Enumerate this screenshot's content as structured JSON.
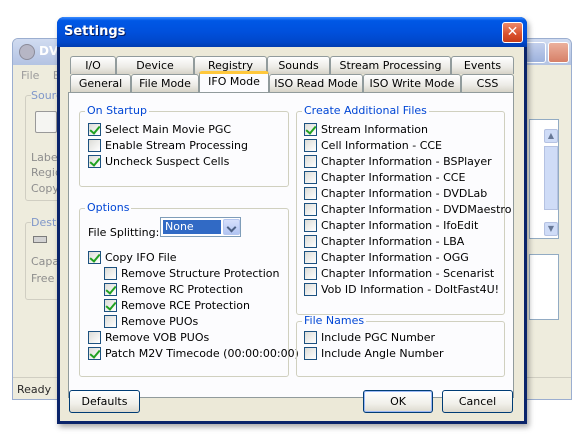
{
  "background_window": {
    "title": "DVD",
    "menu": [
      "File",
      "E"
    ],
    "labels": [
      "Sourc",
      "Label",
      "Regic",
      "Copy",
      "Desti",
      "Capa",
      "Free"
    ],
    "status": "Ready"
  },
  "dialog": {
    "title": "Settings",
    "close_label": "X"
  },
  "tabs": {
    "row1": [
      "I/O",
      "Device",
      "Registry",
      "Sounds",
      "Stream Processing",
      "Events"
    ],
    "row2": [
      "General",
      "File Mode",
      "IFO Mode",
      "ISO Read Mode",
      "ISO Write Mode",
      "CSS"
    ],
    "active": "IFO Mode"
  },
  "on_startup": {
    "title": "On Startup",
    "items": [
      {
        "label": "Select Main Movie PGC",
        "checked": true
      },
      {
        "label": "Enable Stream Processing",
        "checked": false
      },
      {
        "label": "Uncheck Suspect Cells",
        "checked": true
      }
    ]
  },
  "options": {
    "title": "Options",
    "file_splitting_label": "File Splitting:",
    "file_splitting_value": "None",
    "items": [
      {
        "label": "Copy IFO File",
        "checked": true,
        "indent": 0
      },
      {
        "label": "Remove Structure Protection",
        "checked": false,
        "indent": 1
      },
      {
        "label": "Remove RC Protection",
        "checked": true,
        "indent": 1
      },
      {
        "label": "Remove RCE Protection",
        "checked": true,
        "indent": 1
      },
      {
        "label": "Remove PUOs",
        "checked": false,
        "indent": 1
      },
      {
        "label": "Remove VOB PUOs",
        "checked": false,
        "indent": 0
      },
      {
        "label": "Patch M2V Timecode (00:00:00:00)",
        "checked": true,
        "indent": 0
      }
    ]
  },
  "create_files": {
    "title": "Create Additional Files",
    "items": [
      {
        "label": "Stream Information",
        "checked": true
      },
      {
        "label": "Cell Information - CCE",
        "checked": false
      },
      {
        "label": "Chapter Information - BSPlayer",
        "checked": false
      },
      {
        "label": "Chapter Information - CCE",
        "checked": false
      },
      {
        "label": "Chapter Information - DVDLab",
        "checked": false
      },
      {
        "label": "Chapter Information - DVDMaestro",
        "checked": false
      },
      {
        "label": "Chapter Information - IfoEdit",
        "checked": false
      },
      {
        "label": "Chapter Information - LBA",
        "checked": false
      },
      {
        "label": "Chapter Information - OGG",
        "checked": false
      },
      {
        "label": "Chapter Information - Scenarist",
        "checked": false
      },
      {
        "label": "Vob ID Information - DoItFast4U!",
        "checked": false
      }
    ]
  },
  "file_names": {
    "title": "File Names",
    "items": [
      {
        "label": "Include PGC Number",
        "checked": false
      },
      {
        "label": "Include Angle Number",
        "checked": false
      }
    ]
  },
  "buttons": {
    "defaults": "Defaults",
    "ok": "OK",
    "cancel": "Cancel"
  }
}
